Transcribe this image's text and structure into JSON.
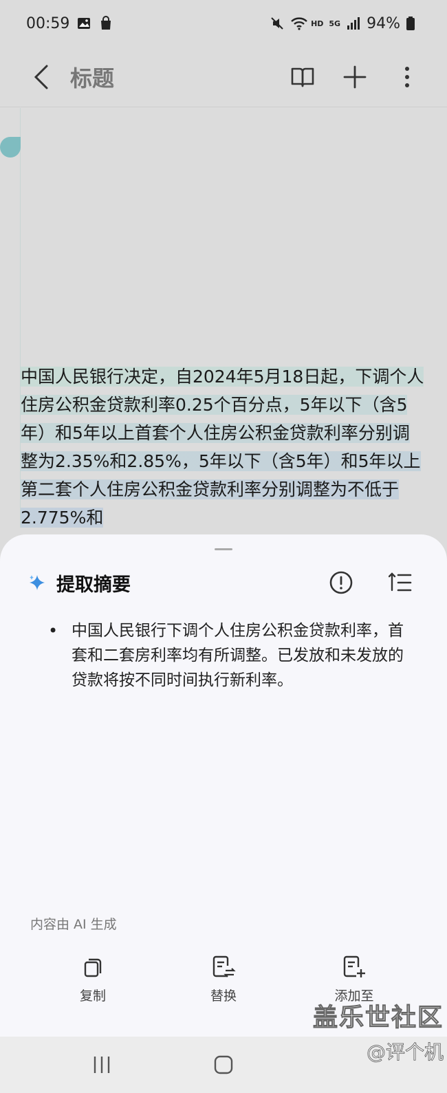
{
  "status_bar": {
    "time": "00:59",
    "hd": "HD",
    "network": "5G",
    "battery": "94%"
  },
  "app_bar": {
    "title": "标题"
  },
  "note": {
    "selected_text": "中国人民银行决定，自2024年5月18日起，下调个人住房公积金贷款利率0.25个百分点，5年以下（含5年）和5年以上首套个人住房公积金贷款利率分别调整为2.35%和2.85%，5年以下（含5年）和5年以上第二套个人住房公积金贷款利率分别调整为不低于2.775%和"
  },
  "sheet": {
    "title": "提取摘要",
    "summary_items": [
      "中国人民银行下调个人住房公积金贷款利率，首套和二套房利率均有所调整。已发放和未发放的贷款将按不同时间执行新利率。"
    ],
    "ai_note": "内容由 AI 生成",
    "actions": {
      "copy": "复制",
      "replace": "替换",
      "add_to": "添加至"
    }
  },
  "watermark": {
    "main": "盖乐世社区",
    "sub": "@评个机"
  },
  "colors": {
    "accent": "#5aa9f0",
    "handle": "#7fbcc0",
    "highlight": "#c6d6d8"
  }
}
